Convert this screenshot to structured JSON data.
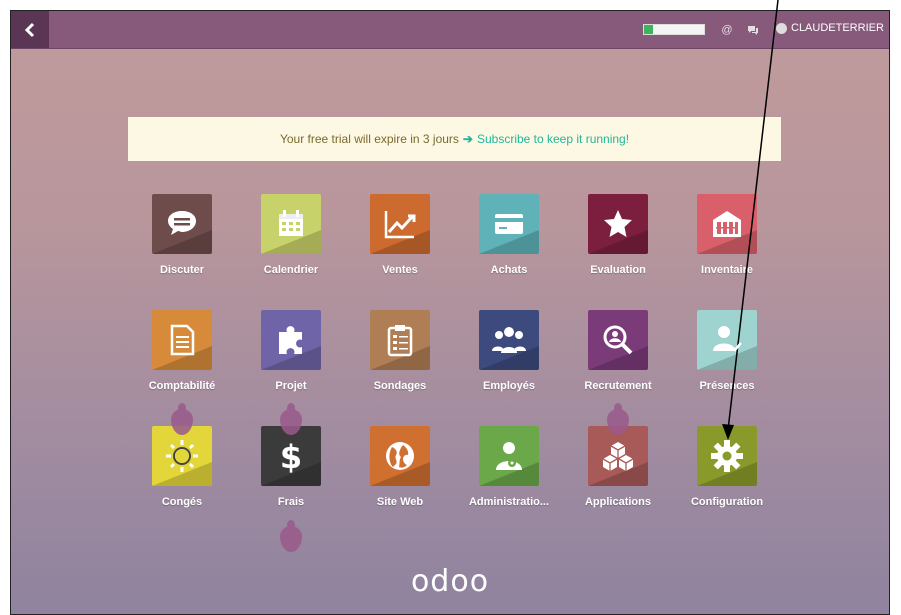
{
  "topbar": {
    "user_name": "CLAUDETERRIER",
    "progress": 0.15,
    "icons": [
      "back-icon",
      "help-icon",
      "chat-icon",
      "user-avatar",
      "caret-down-icon"
    ]
  },
  "trial": {
    "text": "Your free trial will expire in 3 jours",
    "link": "Subscribe to keep it running!"
  },
  "apps": [
    {
      "label": "Discuter",
      "icon": "chat-bubble-icon",
      "color": "#6e4c4c"
    },
    {
      "label": "Calendrier",
      "icon": "calendar-icon",
      "color": "#c8d26a"
    },
    {
      "label": "Ventes",
      "icon": "trend-chart-icon",
      "color": "#cc6a2f"
    },
    {
      "label": "Achats",
      "icon": "credit-card-icon",
      "color": "#5fb3b8"
    },
    {
      "label": "Evaluation",
      "icon": "star-icon",
      "color": "#7c1f3f"
    },
    {
      "label": "Inventaire",
      "icon": "warehouse-icon",
      "color": "#d9606a"
    },
    {
      "label": "Comptabilité",
      "icon": "document-icon",
      "color": "#d78b3a"
    },
    {
      "label": "Projet",
      "icon": "puzzle-icon",
      "color": "#6f64a8"
    },
    {
      "label": "Sondages",
      "icon": "clipboard-icon",
      "color": "#b07e55"
    },
    {
      "label": "Employés",
      "icon": "people-icon",
      "color": "#3c4a7e"
    },
    {
      "label": "Recrutement",
      "icon": "magnifier-icon",
      "color": "#7b3a78"
    },
    {
      "label": "Présences",
      "icon": "person-check-icon",
      "color": "#9fd3cf"
    },
    {
      "label": "Congés",
      "icon": "sun-icon",
      "color": "#e3d63a"
    },
    {
      "label": "Frais",
      "icon": "dollar-icon",
      "color": "#3b3b3b"
    },
    {
      "label": "Site Web",
      "icon": "globe-icon",
      "color": "#cf7030"
    },
    {
      "label": "Administratio...",
      "icon": "user-gear-icon",
      "color": "#6aa84a"
    },
    {
      "label": "Applications",
      "icon": "cubes-icon",
      "color": "#a85a58"
    },
    {
      "label": "Configuration",
      "icon": "gear-icon",
      "color": "#8a9a2a"
    }
  ],
  "logo": "odoo"
}
